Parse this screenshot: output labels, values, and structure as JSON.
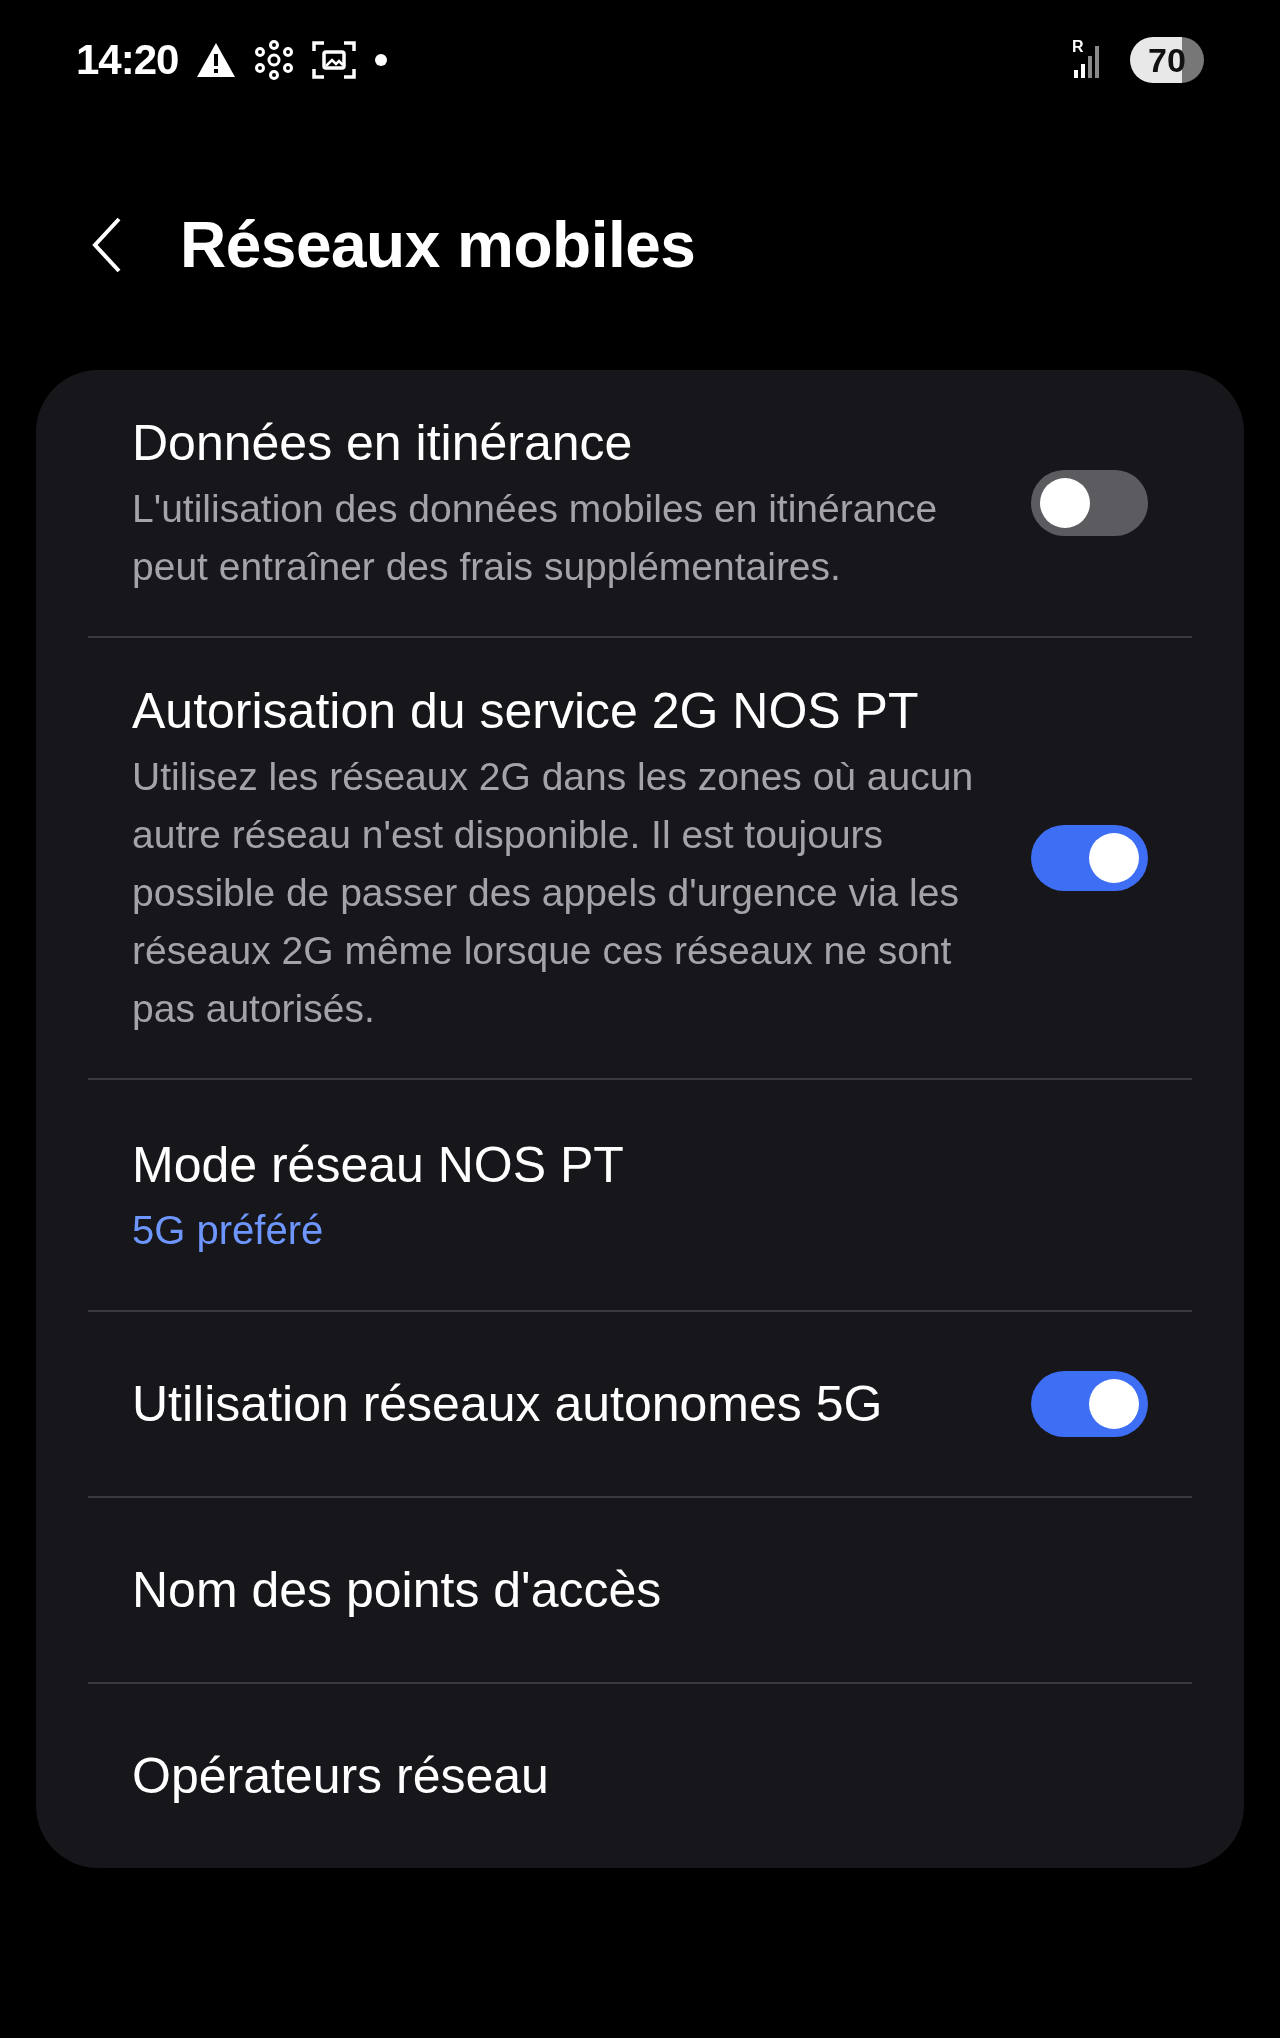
{
  "status_bar": {
    "time": "14:20",
    "signal_label": "R",
    "battery": "70"
  },
  "header": {
    "title": "Réseaux mobiles"
  },
  "settings": [
    {
      "kind": "toggle",
      "title": "Données en itinérance",
      "summary": "L'utilisation des données mobiles en itinérance peut entraîner des frais supplémentaires.",
      "on": false
    },
    {
      "kind": "toggle",
      "title": "Autorisation du service 2G NOS PT",
      "summary": "Utilisez les réseaux 2G dans les zones où aucun autre réseau n'est disponible. Il est toujours possible de passer des appels d'urgence via les réseaux 2G même lorsque ces réseaux ne sont pas autorisés.",
      "on": true
    },
    {
      "kind": "value",
      "title": "Mode réseau NOS PT",
      "value": "5G préféré"
    },
    {
      "kind": "toggle",
      "title": "Utilisation réseaux autonomes 5G",
      "on": true
    },
    {
      "kind": "link",
      "title": "Nom des points d'accès"
    },
    {
      "kind": "link",
      "title": "Opérateurs réseau"
    }
  ]
}
